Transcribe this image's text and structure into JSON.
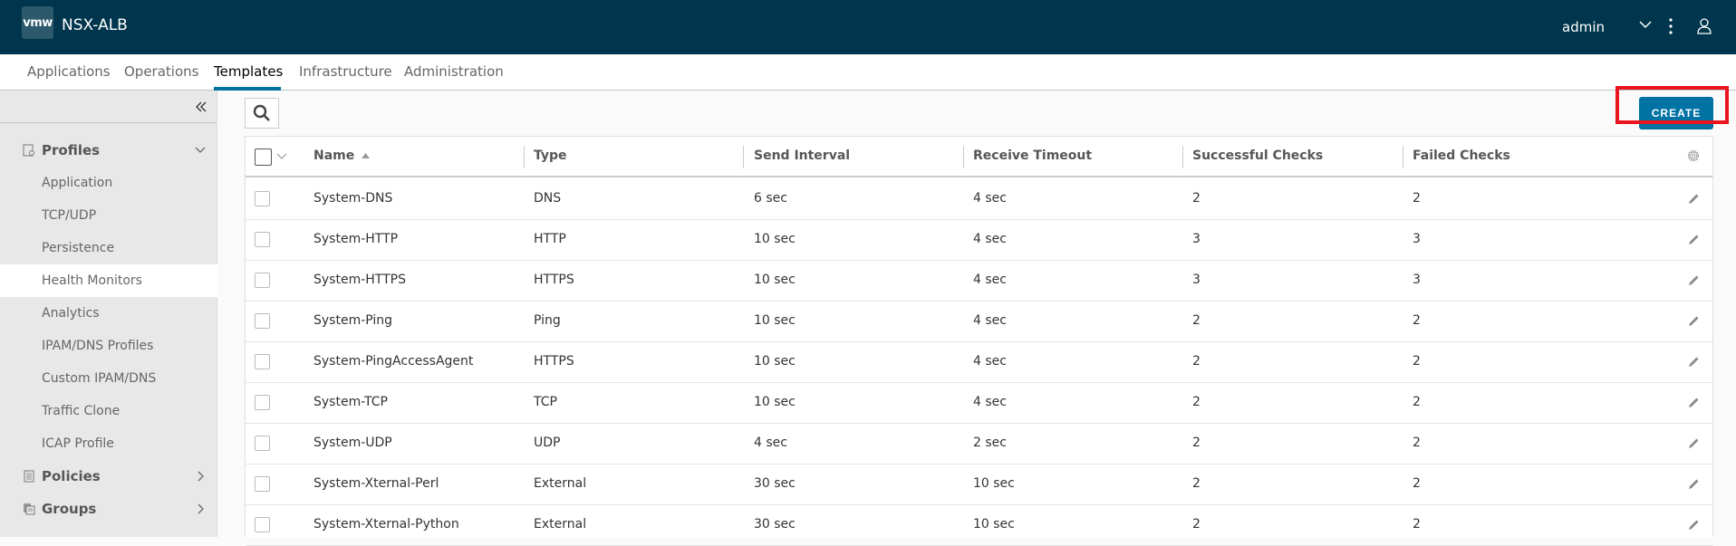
{
  "header": {
    "logo_text": "vmw",
    "app_title": "NSX-ALB",
    "user_name": "admin"
  },
  "nav": {
    "tabs": [
      {
        "label": "Applications",
        "active": false
      },
      {
        "label": "Operations",
        "active": false
      },
      {
        "label": "Templates",
        "active": true
      },
      {
        "label": "Infrastructure",
        "active": false
      },
      {
        "label": "Administration",
        "active": false
      }
    ]
  },
  "sidebar": {
    "sections": [
      {
        "label": "Profiles",
        "icon": "profile-settings-icon",
        "expanded": true,
        "items": [
          {
            "label": "Application",
            "active": false
          },
          {
            "label": "TCP/UDP",
            "active": false
          },
          {
            "label": "Persistence",
            "active": false
          },
          {
            "label": "Health Monitors",
            "active": true
          },
          {
            "label": "Analytics",
            "active": false
          },
          {
            "label": "IPAM/DNS Profiles",
            "active": false
          },
          {
            "label": "Custom IPAM/DNS",
            "active": false
          },
          {
            "label": "Traffic Clone",
            "active": false
          },
          {
            "label": "ICAP Profile",
            "active": false
          }
        ]
      },
      {
        "label": "Policies",
        "icon": "policy-document-icon",
        "expanded": false
      },
      {
        "label": "Groups",
        "icon": "groups-stack-icon",
        "expanded": false
      }
    ]
  },
  "toolbar": {
    "create_label": "CREATE"
  },
  "table": {
    "columns": [
      "Name",
      "Type",
      "Send Interval",
      "Receive Timeout",
      "Successful Checks",
      "Failed Checks"
    ],
    "sort": {
      "column": "Name",
      "direction": "ascending"
    },
    "rows": [
      {
        "name": "System-DNS",
        "type": "DNS",
        "send_interval": "6 sec",
        "receive_timeout": "4 sec",
        "successful_checks": "2",
        "failed_checks": "2"
      },
      {
        "name": "System-HTTP",
        "type": "HTTP",
        "send_interval": "10 sec",
        "receive_timeout": "4 sec",
        "successful_checks": "3",
        "failed_checks": "3"
      },
      {
        "name": "System-HTTPS",
        "type": "HTTPS",
        "send_interval": "10 sec",
        "receive_timeout": "4 sec",
        "successful_checks": "3",
        "failed_checks": "3"
      },
      {
        "name": "System-Ping",
        "type": "Ping",
        "send_interval": "10 sec",
        "receive_timeout": "4 sec",
        "successful_checks": "2",
        "failed_checks": "2"
      },
      {
        "name": "System-PingAccessAgent",
        "type": "HTTPS",
        "send_interval": "10 sec",
        "receive_timeout": "4 sec",
        "successful_checks": "2",
        "failed_checks": "2"
      },
      {
        "name": "System-TCP",
        "type": "TCP",
        "send_interval": "10 sec",
        "receive_timeout": "4 sec",
        "successful_checks": "2",
        "failed_checks": "2"
      },
      {
        "name": "System-UDP",
        "type": "UDP",
        "send_interval": "4 sec",
        "receive_timeout": "2 sec",
        "successful_checks": "2",
        "failed_checks": "2"
      },
      {
        "name": "System-Xternal-Perl",
        "type": "External",
        "send_interval": "30 sec",
        "receive_timeout": "10 sec",
        "successful_checks": "2",
        "failed_checks": "2"
      },
      {
        "name": "System-Xternal-Python",
        "type": "External",
        "send_interval": "30 sec",
        "receive_timeout": "10 sec",
        "successful_checks": "2",
        "failed_checks": "2"
      }
    ]
  },
  "colors": {
    "header_bg": "#00364d",
    "accent": "#0072a3",
    "highlight": "#e8141e"
  }
}
